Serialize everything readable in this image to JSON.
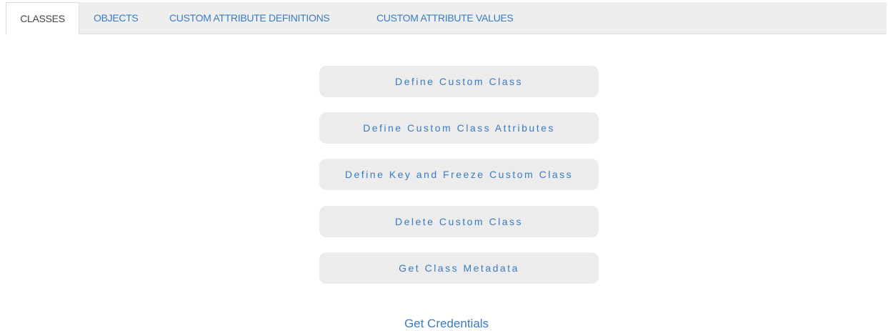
{
  "tabs": [
    {
      "label": "CLASSES",
      "active": true
    },
    {
      "label": "OBJECTS",
      "active": false
    },
    {
      "label": "CUSTOM ATTRIBUTE DEFINITIONS",
      "active": false
    },
    {
      "label": "CUSTOM ATTRIBUTE VALUES",
      "active": false
    }
  ],
  "actions": [
    {
      "label": "Define Custom Class"
    },
    {
      "label": "Define Custom Class Attributes"
    },
    {
      "label": "Define Key and Freeze Custom Class"
    },
    {
      "label": "Delete Custom Class"
    },
    {
      "label": "Get Class Metadata"
    }
  ],
  "footer": {
    "link_label": "Get Credentials"
  },
  "colors": {
    "link": "#3a7bc0",
    "active_tab_text": "#444444",
    "tabbar_bg": "#eeeeee",
    "button_bg": "#ececec"
  }
}
